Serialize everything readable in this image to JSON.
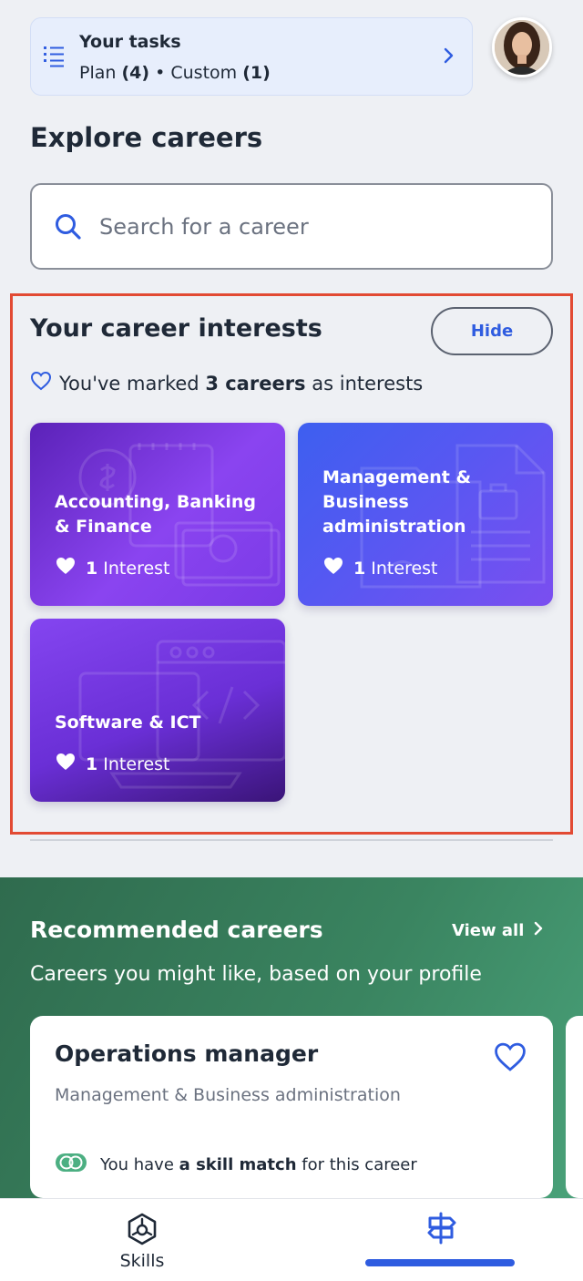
{
  "tasks": {
    "title": "Your tasks",
    "plan_label": "Plan",
    "plan_count": "(4)",
    "separator": "•",
    "custom_label": "Custom",
    "custom_count": "(1)"
  },
  "page_title": "Explore careers",
  "search": {
    "placeholder": "Search for a career",
    "value": ""
  },
  "interests": {
    "title": "Your career interests",
    "hide_label": "Hide",
    "summary_prefix": "You've marked",
    "summary_count": "3 careers",
    "summary_suffix": "as interests",
    "cards": [
      {
        "title": "Accounting, Banking & Finance",
        "count": "1",
        "count_label": "Interest",
        "icon": "money-icon"
      },
      {
        "title": "Management & Business administration",
        "count": "1",
        "count_label": "Interest",
        "icon": "document-icon"
      },
      {
        "title": "Software & ICT",
        "count": "1",
        "count_label": "Interest",
        "icon": "code-window-icon"
      }
    ]
  },
  "recommended": {
    "title": "Recommended careers",
    "view_all_label": "View all",
    "subtitle": "Careers you might like, based on your profile",
    "card": {
      "title": "Operations manager",
      "category": "Management & Business administration",
      "match_prefix": "You have",
      "match_bold": "a skill match",
      "match_suffix": "for this career"
    }
  },
  "nav": {
    "skills_label": "Skills"
  },
  "colors": {
    "accent": "#2f5ce0",
    "highlight_border": "#e24a33",
    "recommended_bg": "#3a8460"
  }
}
